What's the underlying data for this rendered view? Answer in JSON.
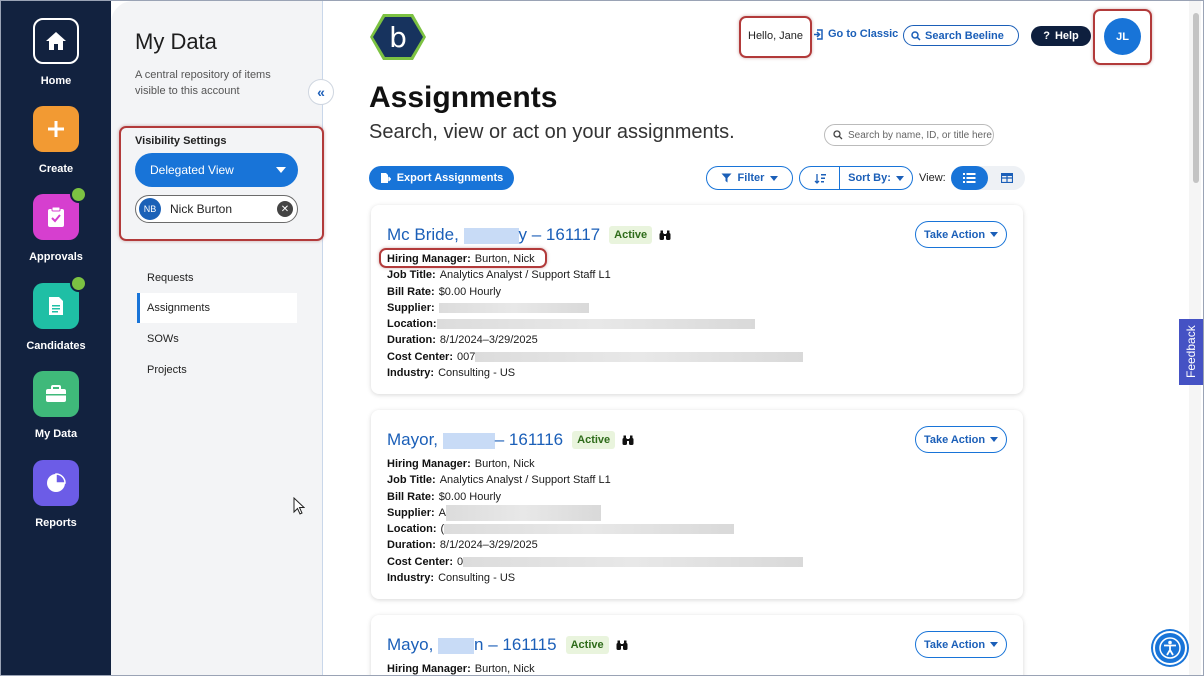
{
  "rail": {
    "items": [
      {
        "label": "Home",
        "icon": "home-icon",
        "color": "#12223f"
      },
      {
        "label": "Create",
        "icon": "plus-icon",
        "color": "#f29a33"
      },
      {
        "label": "Approvals",
        "icon": "clipboard-check-icon",
        "color": "#d63fcf"
      },
      {
        "label": "Candidates",
        "icon": "document-icon",
        "color": "#1fbfa5"
      },
      {
        "label": "My Data",
        "icon": "briefcase-icon",
        "color": "#3fb97a"
      },
      {
        "label": "Reports",
        "icon": "pie-chart-icon",
        "color": "#6c5ce7"
      }
    ]
  },
  "sidebar": {
    "title": "My Data",
    "description": "A central repository of items visible to this account",
    "visibility_label": "Visibility Settings",
    "view_select": "Delegated View",
    "delegate": {
      "initials": "NB",
      "name": "Nick Burton"
    },
    "nav": [
      "Requests",
      "Assignments",
      "SOWs",
      "Projects"
    ],
    "active_nav": "Assignments"
  },
  "header": {
    "logo_letter": "b",
    "greeting": "Hello, Jane",
    "classic_link": "Go to Classic",
    "search_placeholder": "Search Beeline",
    "help_label": "Help",
    "avatar_initials": "JL"
  },
  "page": {
    "title": "Assignments",
    "subtitle": "Search, view or act on your assignments.",
    "search_placeholder": "Search by name, ID, or title here"
  },
  "toolbar": {
    "export_label": "Export Assignments",
    "filter_label": "Filter",
    "sort_label": "Sort By:",
    "view_label": "View:"
  },
  "cards": [
    {
      "name_prefix": "Mc Bride, ",
      "name_suffix": "y – 161117",
      "status": "Active",
      "action_label": "Take Action",
      "fields": [
        {
          "label": "Hiring Manager:",
          "value": "Burton, Nick"
        },
        {
          "label": "Job Title:",
          "value": "Analytics Analyst / Support Staff L1"
        },
        {
          "label": "Bill Rate:",
          "value": "$0.00 Hourly"
        },
        {
          "label": "Supplier:",
          "value": ""
        },
        {
          "label": "Location:",
          "value": ""
        },
        {
          "label": "Duration:",
          "value": "8/1/2024–3/29/2025"
        },
        {
          "label": "Cost Center:",
          "value": "007"
        },
        {
          "label": "Industry:",
          "value": "Consulting - US"
        }
      ]
    },
    {
      "name_prefix": "Mayor, ",
      "name_suffix": "– 161116",
      "status": "Active",
      "action_label": "Take Action",
      "fields": [
        {
          "label": "Hiring Manager:",
          "value": "Burton, Nick"
        },
        {
          "label": "Job Title:",
          "value": "Analytics Analyst / Support Staff L1"
        },
        {
          "label": "Bill Rate:",
          "value": "$0.00 Hourly"
        },
        {
          "label": "Supplier:",
          "value": "A"
        },
        {
          "label": "Location:",
          "value": "("
        },
        {
          "label": "Duration:",
          "value": "8/1/2024–3/29/2025"
        },
        {
          "label": "Cost Center:",
          "value": "0"
        },
        {
          "label": "Industry:",
          "value": "Consulting - US"
        }
      ]
    },
    {
      "name_prefix": "Mayo, ",
      "name_suffix": "n – 161115",
      "status": "Active",
      "action_label": "Take Action",
      "fields": [
        {
          "label": "Hiring Manager:",
          "value": "Burton, Nick"
        }
      ]
    }
  ],
  "feedback_label": "Feedback",
  "colors": {
    "rail_bg": "#12223f",
    "accent": "#1874d8",
    "link": "#1b5fb8",
    "highlight": "#b23a3a",
    "feedback": "#4552c4"
  }
}
